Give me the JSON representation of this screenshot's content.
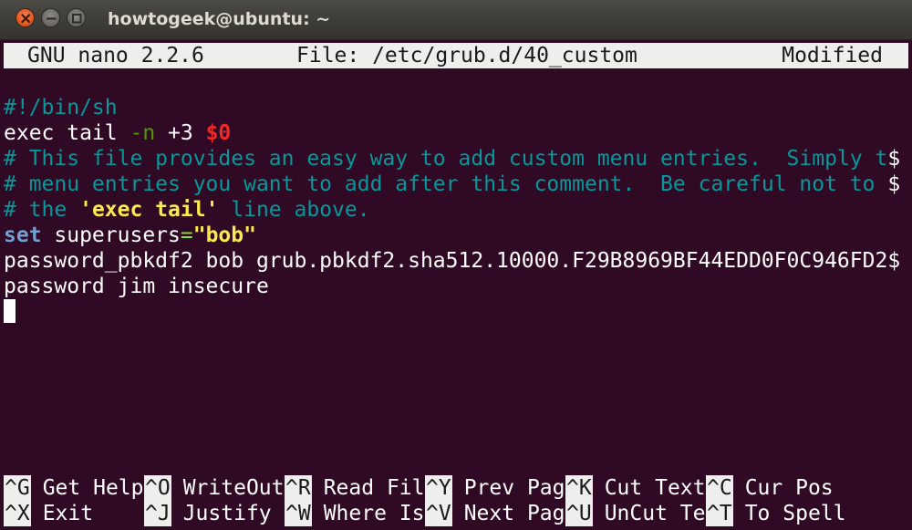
{
  "window": {
    "title": "howtogeek@ubuntu: ~"
  },
  "nano": {
    "version": "GNU nano 2.2.6",
    "file": "File: /etc/grub.d/40_custom",
    "status": "Modified"
  },
  "editor": {
    "lines": [
      {
        "id": "shebang",
        "segments": [
          {
            "text": "#!/bin/sh",
            "cls": "c-comment"
          }
        ]
      },
      {
        "id": "exec-tail",
        "segments": [
          {
            "text": "exec tail ",
            "cls": "c-plain"
          },
          {
            "text": "-n",
            "cls": "c-option"
          },
          {
            "text": " +3 ",
            "cls": "c-plain"
          },
          {
            "text": "$0",
            "cls": "c-var"
          }
        ]
      },
      {
        "id": "comment-1",
        "segments": [
          {
            "text": "# This file provides an easy way to add custom menu entries.  Simply t",
            "cls": "c-comment"
          },
          {
            "text": "$",
            "cls": "c-trunc"
          }
        ]
      },
      {
        "id": "comment-2",
        "segments": [
          {
            "text": "# menu entries you want to add after this comment.  Be careful not to ",
            "cls": "c-comment"
          },
          {
            "text": "$",
            "cls": "c-trunc"
          }
        ]
      },
      {
        "id": "comment-3",
        "segments": [
          {
            "text": "# the ",
            "cls": "c-comment"
          },
          {
            "text": "'exec tail'",
            "cls": "c-string"
          },
          {
            "text": " line above.",
            "cls": "c-comment"
          }
        ]
      },
      {
        "id": "set-superusers",
        "segments": [
          {
            "text": "set",
            "cls": "c-keyword"
          },
          {
            "text": " superusers",
            "cls": "c-plain"
          },
          {
            "text": "=",
            "cls": "c-op"
          },
          {
            "text": "\"bob\"",
            "cls": "c-string"
          }
        ]
      },
      {
        "id": "password-pbkdf2",
        "segments": [
          {
            "text": "password_pbkdf2 bob grub.pbkdf2.sha512.10000.F29B8969BF44EDD0F0C946FD2",
            "cls": "c-plain"
          },
          {
            "text": "$",
            "cls": "c-trunc"
          }
        ]
      },
      {
        "id": "password-jim",
        "segments": [
          {
            "text": "password jim insecure",
            "cls": "c-plain"
          }
        ]
      }
    ]
  },
  "shortcuts": {
    "row1": [
      {
        "key": "^G",
        "label": "Get Help",
        "name": "get-help"
      },
      {
        "key": "^O",
        "label": "WriteOut",
        "name": "writeout"
      },
      {
        "key": "^R",
        "label": "Read Fil",
        "name": "read-file"
      },
      {
        "key": "^Y",
        "label": "Prev Pag",
        "name": "prev-page"
      },
      {
        "key": "^K",
        "label": "Cut Text",
        "name": "cut-text"
      },
      {
        "key": "^C",
        "label": "Cur Pos",
        "name": "cur-pos"
      }
    ],
    "row2": [
      {
        "key": "^X",
        "label": "Exit",
        "name": "exit"
      },
      {
        "key": "^J",
        "label": "Justify",
        "name": "justify"
      },
      {
        "key": "^W",
        "label": "Where Is",
        "name": "where-is"
      },
      {
        "key": "^V",
        "label": "Next Pag",
        "name": "next-page"
      },
      {
        "key": "^U",
        "label": "UnCut Te",
        "name": "uncut-text"
      },
      {
        "key": "^T",
        "label": "To Spell",
        "name": "to-spell"
      }
    ]
  },
  "colors": {
    "terminal_bg": "#300a24",
    "comment": "#06989a",
    "keyword": "#729fcf",
    "string": "#fce94f",
    "variable": "#ef2929",
    "option": "#4e9a06",
    "header_bg": "#eeeeec"
  },
  "icons": {
    "close": "close-icon",
    "minimize": "minimize-icon",
    "maximize": "maximize-icon"
  }
}
